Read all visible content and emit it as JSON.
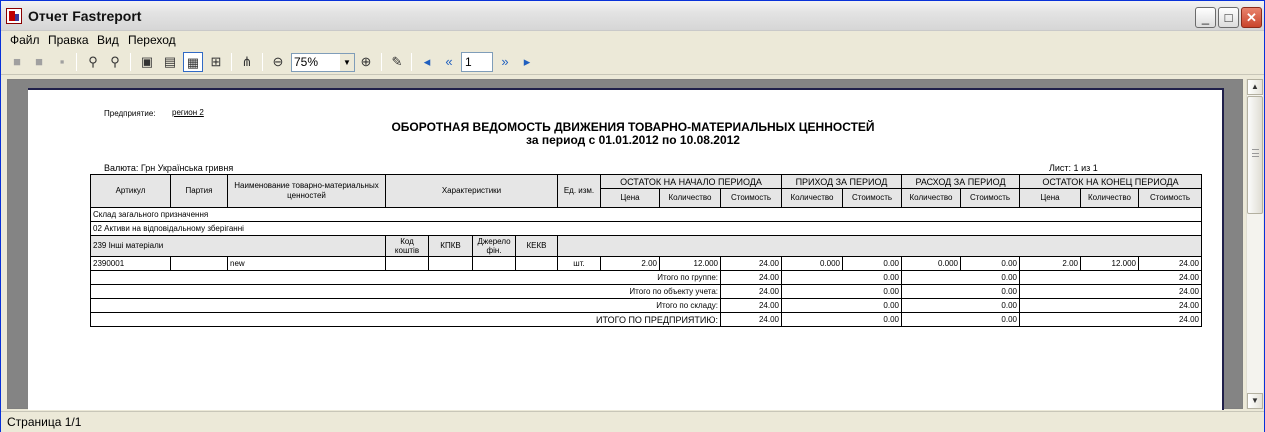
{
  "window": {
    "title": "Отчет Fastreport"
  },
  "menu": [
    "Файл",
    "Правка",
    "Вид",
    "Переход"
  ],
  "toolbar": {
    "zoom": "75%",
    "page": "1"
  },
  "status": "Страница 1/1",
  "report": {
    "enterprise_label": "Предприятие:",
    "enterprise_value": "регион 2",
    "title": "ОБОРОТНАЯ ВЕДОМОСТЬ ДВИЖЕНИЯ ТОВАРНО-МАТЕРИАЛЬНЫХ ЦЕННОСТЕЙ",
    "period": "за период с 01.01.2012 по 10.08.2012",
    "currency": "Валюта: Грн   Українська гривня",
    "sheet": "Лист: 1 из 1",
    "headers": {
      "article": "Артикул",
      "party": "Партия",
      "name": "Наименование товарно-материальных ценностей",
      "characteristics": "Характеристики",
      "unit": "Ед. изм.",
      "opening": "ОСТАТОК НА НАЧАЛО ПЕРИОДА",
      "income": "ПРИХОД ЗА ПЕРИОД",
      "expense": "РАСХОД ЗА ПЕРИОД",
      "closing": "ОСТАТОК НА КОНЕЦ ПЕРИОДА",
      "price": "Цена",
      "qty": "Количество",
      "cost": "Стоимость"
    },
    "warehouse": "Склад загального призначення",
    "object": "02 Активи на відповідальному зберіганні",
    "group": {
      "name": "239 Інші матеріали",
      "kod": "Код коштів",
      "kpkv": "КПКВ",
      "dzherelo": "Джерело фін.",
      "kekv": "КЕКВ"
    },
    "item": {
      "article": "2390001",
      "party": "",
      "name": "new",
      "unit": "шт.",
      "open_price": "2.00",
      "open_qty": "12.000",
      "open_cost": "24.00",
      "in_qty": "0.000",
      "in_cost": "0.00",
      "out_qty": "0.000",
      "out_cost": "0.00",
      "close_price": "2.00",
      "close_qty": "12.000",
      "close_cost": "24.00"
    },
    "totals": [
      {
        "label": "Итого по группе:",
        "open": "24.00",
        "in": "0.00",
        "out": "0.00",
        "close": "24.00"
      },
      {
        "label": "Итого по объекту учета:",
        "open": "24.00",
        "in": "0.00",
        "out": "0.00",
        "close": "24.00"
      },
      {
        "label": "Итого по складу:",
        "open": "24.00",
        "in": "0.00",
        "out": "0.00",
        "close": "24.00"
      },
      {
        "label": "ИТОГО ПО ПРЕДПРИЯТИЮ:",
        "open": "24.00",
        "in": "0.00",
        "out": "0.00",
        "close": "24.00"
      }
    ]
  }
}
